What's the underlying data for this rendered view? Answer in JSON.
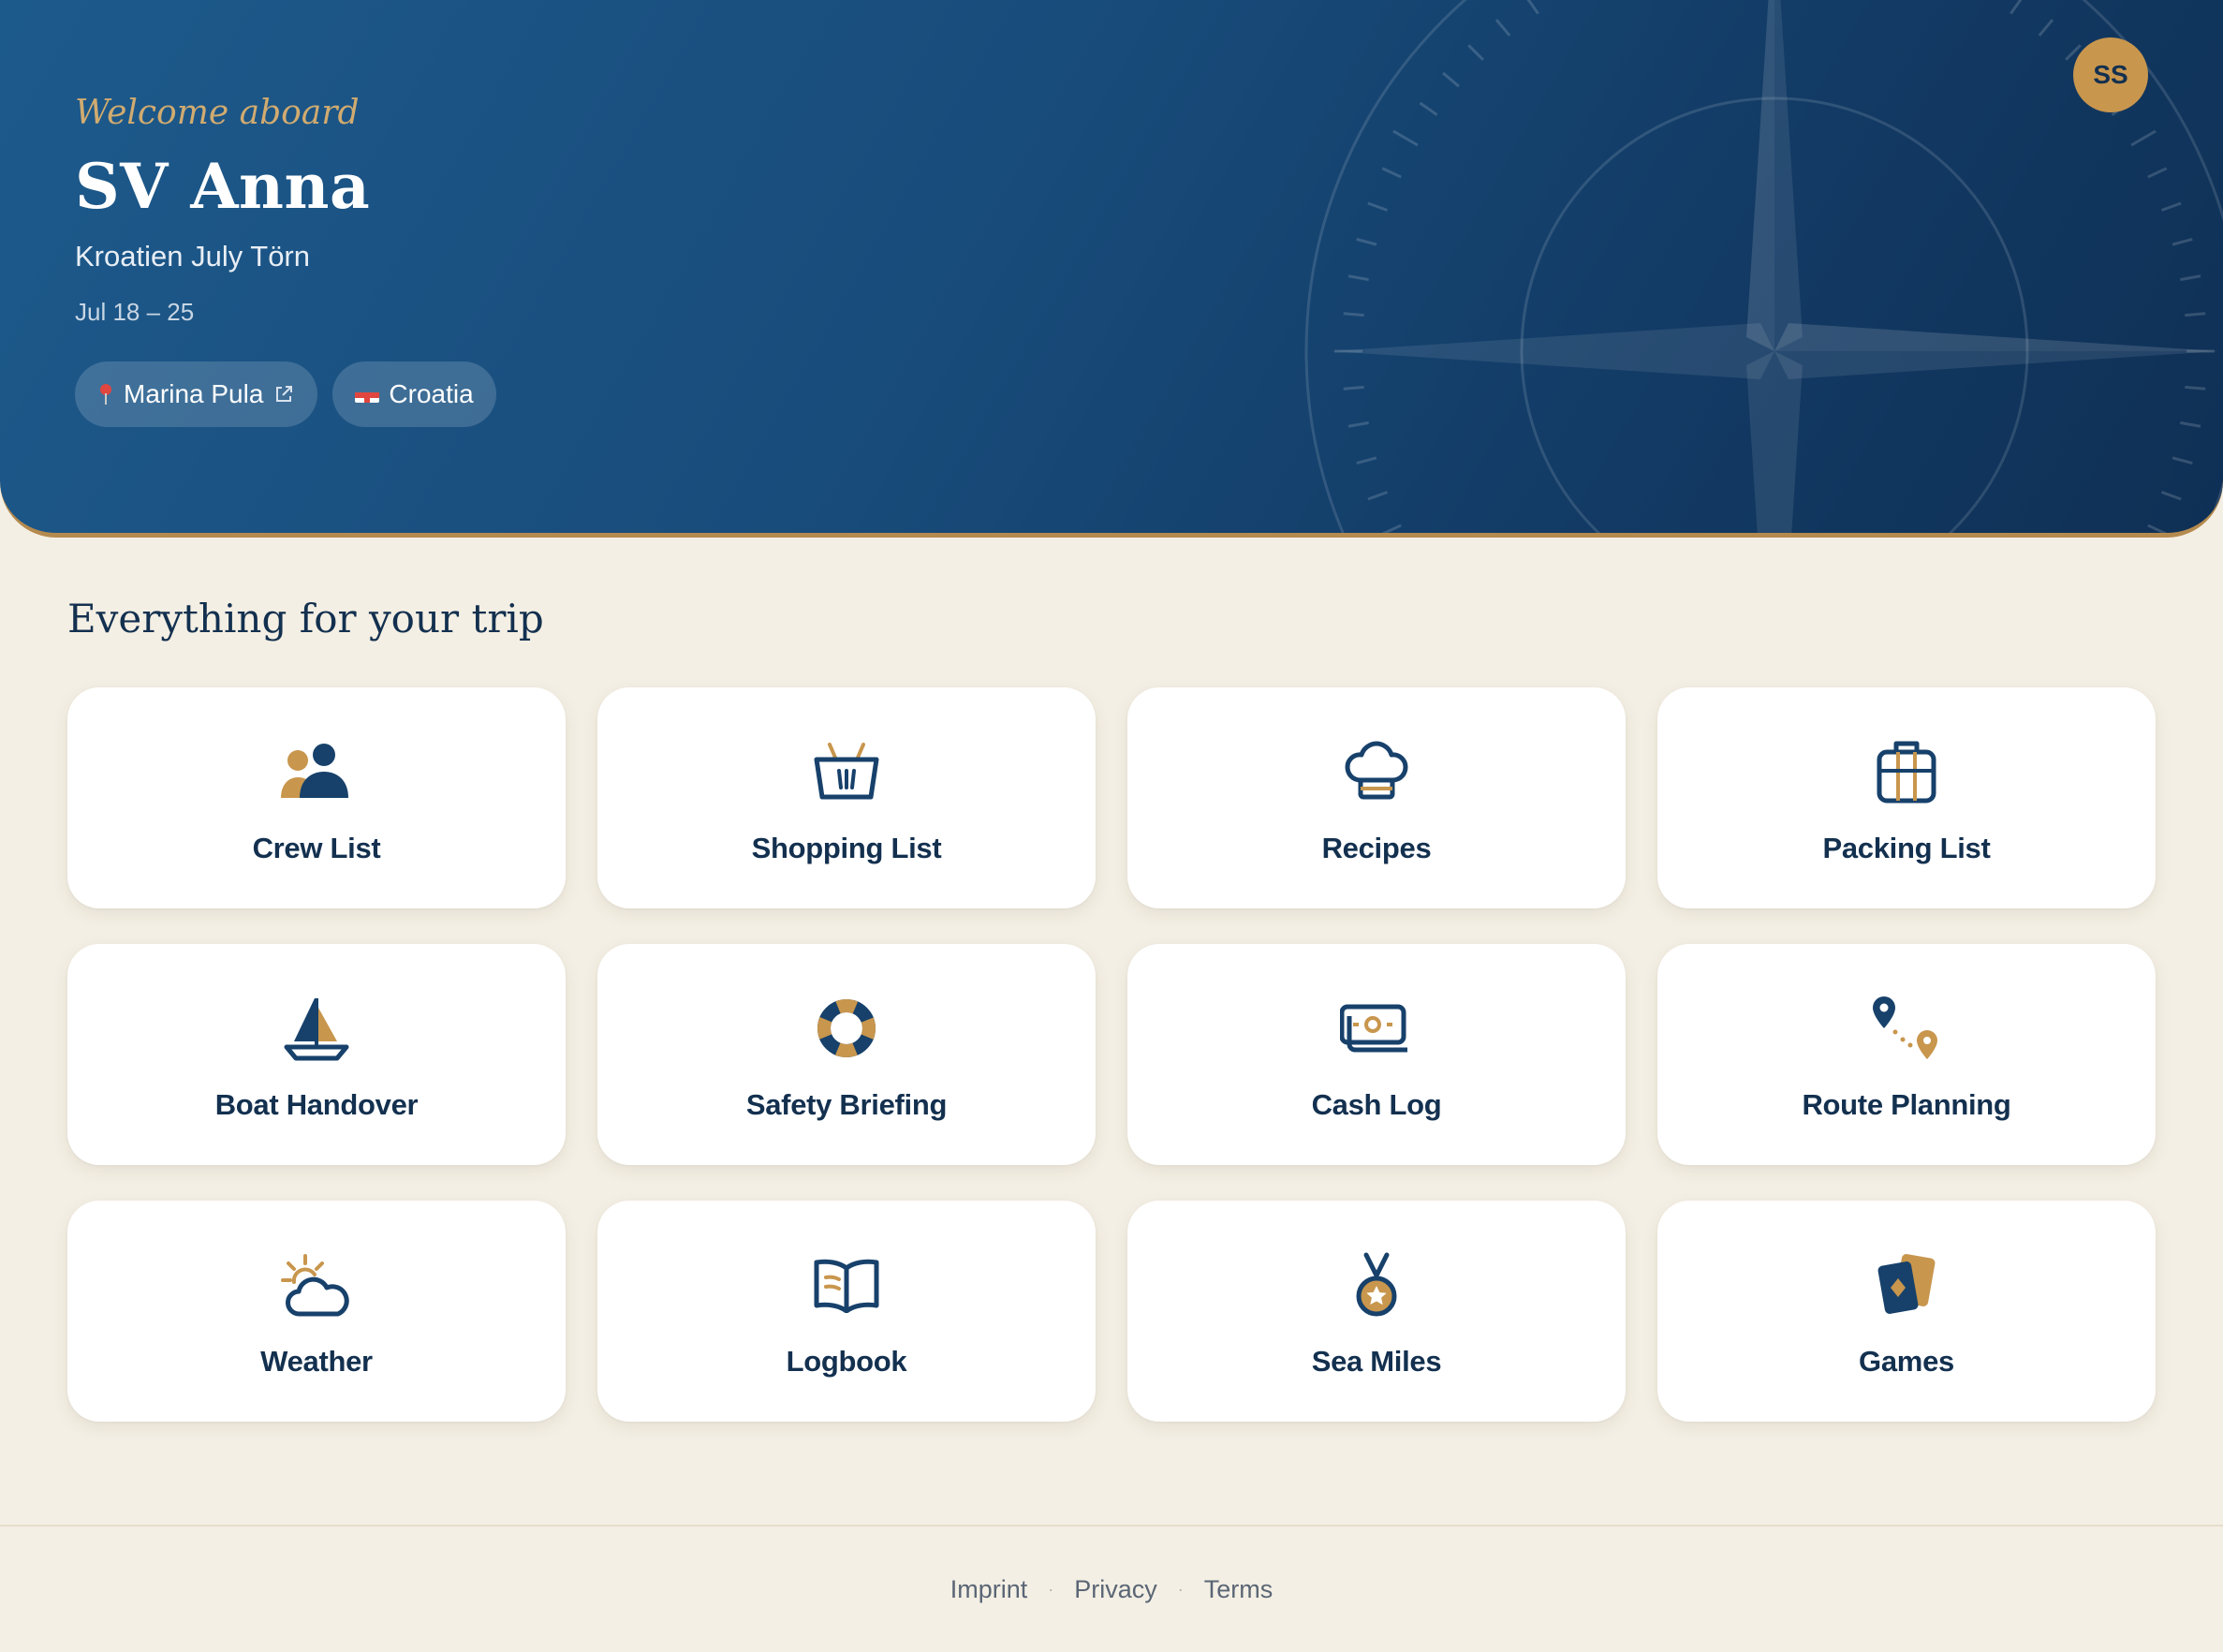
{
  "header": {
    "welcome": "Welcome aboard",
    "boat_name": "SV Anna",
    "trip_name": "Kroatien July Törn",
    "dates": "Jul 18 – 25",
    "marina_chip": "Marina Pula",
    "country_chip": "Croatia",
    "avatar_initials": "SS"
  },
  "section": {
    "title": "Everything for your trip"
  },
  "tiles": [
    {
      "label": "Crew List",
      "icon": "crew-icon"
    },
    {
      "label": "Shopping List",
      "icon": "basket-icon"
    },
    {
      "label": "Recipes",
      "icon": "chef-hat-icon"
    },
    {
      "label": "Packing List",
      "icon": "suitcase-icon"
    },
    {
      "label": "Boat Handover",
      "icon": "sailboat-icon"
    },
    {
      "label": "Safety Briefing",
      "icon": "lifebuoy-icon"
    },
    {
      "label": "Cash Log",
      "icon": "money-icon"
    },
    {
      "label": "Route Planning",
      "icon": "route-icon"
    },
    {
      "label": "Weather",
      "icon": "weather-icon"
    },
    {
      "label": "Logbook",
      "icon": "book-icon"
    },
    {
      "label": "Sea Miles",
      "icon": "medal-icon"
    },
    {
      "label": "Games",
      "icon": "cards-icon"
    }
  ],
  "footer": {
    "links": [
      "Imprint",
      "Privacy",
      "Terms"
    ]
  },
  "colors": {
    "navy": "#13304f",
    "gold": "#c8964d",
    "background": "#f4efe4"
  }
}
